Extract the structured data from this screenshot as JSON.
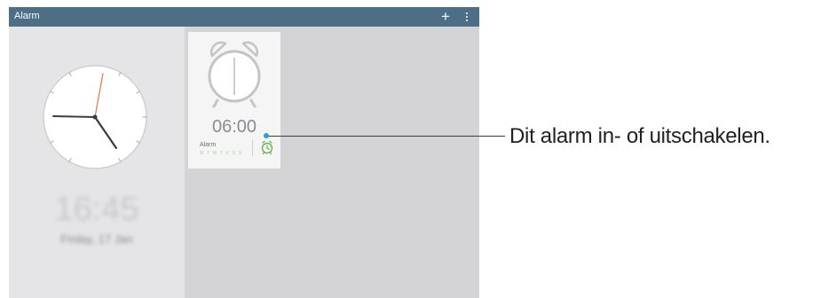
{
  "app": {
    "title": "Alarm"
  },
  "toolbar": {
    "add_icon": "+",
    "menu_icon": "overflow-menu-icon"
  },
  "clock": {
    "time": "16:45",
    "date": "Friday, 17 Jan"
  },
  "alarm_card": {
    "time": "06:00",
    "name": "Alarm",
    "days": "M T W T F S S",
    "active_days_color": "#a8d39a",
    "toggle_icon": "alarm-clock-icon",
    "toggle_color": "#6cb24a"
  },
  "callout": {
    "text": "Dit alarm in- of uitschakelen."
  },
  "colors": {
    "topbar": "#4d6f86",
    "screen_bg": "#d4d4d6",
    "callout_dot": "#2a9fd0"
  }
}
